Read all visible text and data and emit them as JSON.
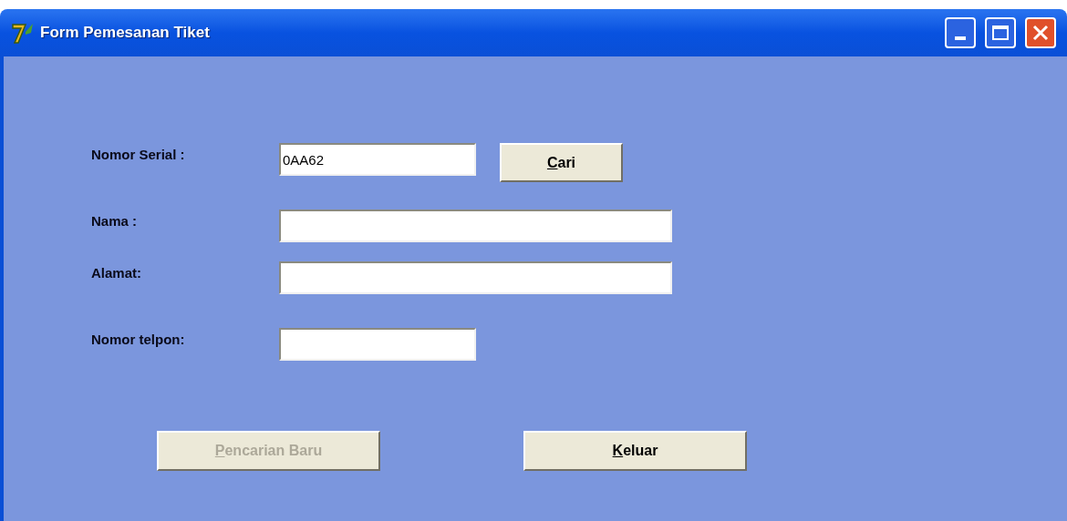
{
  "window": {
    "title": "Form Pemesanan Tiket"
  },
  "fields": [
    {
      "label": "Nomor Serial :",
      "value": "0AA62",
      "button": {
        "label": "Cari"
      }
    },
    {
      "label": "Nama :"
    },
    {
      "label": "Alamat:"
    },
    {
      "label": "Nomor telpon:"
    }
  ],
  "buttons": [
    {
      "label": "Pencarian Baru",
      "disabled": true
    },
    {
      "label": "Keluar",
      "disabled": false
    }
  ]
}
